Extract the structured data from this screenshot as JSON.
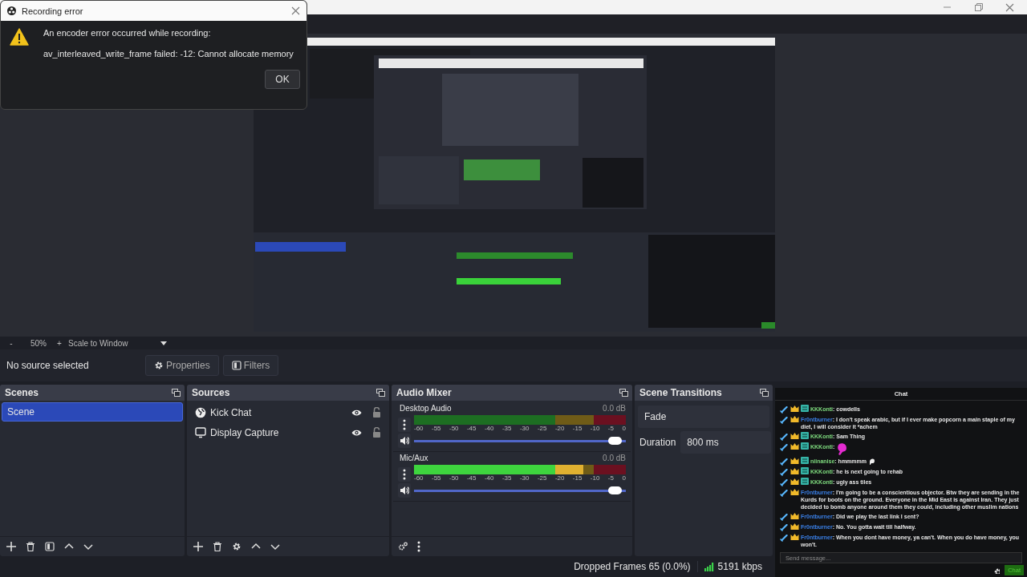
{
  "dialog": {
    "title": "Recording error",
    "message": "An encoder error occurred while recording:",
    "detail": "av_interleaved_write_frame failed: -12: Cannot allocate memory",
    "button": "OK"
  },
  "preview_toolbar": {
    "zoom_out": "-",
    "zoom": "50%",
    "zoom_in": "+",
    "scale_mode": "Scale to Window"
  },
  "source_bar": {
    "status": "No source selected",
    "properties": "Properties",
    "filters": "Filters"
  },
  "scenes": {
    "title": "Scenes",
    "items": [
      {
        "name": "Scene",
        "selected": true
      }
    ]
  },
  "sources": {
    "title": "Sources",
    "items": [
      {
        "name": "Kick Chat",
        "kind": "browser",
        "visible": true,
        "locked": false
      },
      {
        "name": "Display Capture",
        "kind": "display",
        "visible": true,
        "locked": false
      }
    ]
  },
  "audio_mixer": {
    "title": "Audio Mixer",
    "channels": [
      {
        "name": "Desktop Audio",
        "reading": "0.0 dB",
        "meter": {
          "level": 0
        },
        "scale": [
          "-60",
          "-55",
          "-50",
          "-45",
          "-40",
          "-35",
          "-30",
          "-25",
          "-20",
          "-15",
          "-10",
          "-5",
          "0"
        ],
        "volume": {
          "level": 1
        }
      },
      {
        "name": "Mic/Aux",
        "reading": "0.0 dB",
        "meter": {
          "level": 0.8
        },
        "scale": [
          "-60",
          "-55",
          "-50",
          "-45",
          "-40",
          "-35",
          "-30",
          "-25",
          "-20",
          "-15",
          "-10",
          "-5",
          "0"
        ],
        "volume": {
          "level": 1
        }
      }
    ]
  },
  "scene_transitions": {
    "title": "Scene Transitions",
    "transition": "Fade",
    "duration_label": "Duration",
    "duration": "800 ms"
  },
  "status_bar": {
    "dropped_frames": "Dropped Frames 65 (0.0%)",
    "bitrate": "5191 kbps"
  },
  "chat": {
    "title": "Chat",
    "messages": [
      {
        "user": "KKKonti",
        "color": "#7fdc7f",
        "subscriber": true,
        "text": ": cowdells",
        "emote": false
      },
      {
        "user": "Fr0ntburner",
        "color": "#3a7fe6",
        "subscriber": false,
        "text": ": I don't speak arabic, but if I ever make popcorn a main staple of my diet, I will consider it *achem",
        "emote": false
      },
      {
        "user": "KKKonti",
        "color": "#7fdc7f",
        "subscriber": true,
        "text": ": Sam Thing",
        "emote": false
      },
      {
        "user": "KKKonti",
        "color": "#7fdc7f",
        "subscriber": true,
        "text": ":",
        "emote": true
      },
      {
        "user": "niinanise",
        "color": "#7fdc7f",
        "subscriber": true,
        "text": ": hmmmmm",
        "emote": true
      },
      {
        "user": "KKKonti",
        "color": "#7fdc7f",
        "subscriber": true,
        "text": ": he is next going to rehab",
        "emote": false
      },
      {
        "user": "KKKonti",
        "color": "#7fdc7f",
        "subscriber": true,
        "text": ": ugly ass tiles",
        "emote": false
      },
      {
        "user": "Fr0ntburner",
        "color": "#3a7fe6",
        "subscriber": false,
        "text": ": I'm going to be a conscientious objector. Btw they are sending in the Kurds for boots on the ground. Everyone in the Mid East is against Iran. They just decided to bomb anyone around them they could, including other muslim nations",
        "emote": false
      },
      {
        "user": "Fr0ntburner",
        "color": "#3a7fe6",
        "subscriber": false,
        "text": ": Did we play the last link I sent?",
        "emote": false
      },
      {
        "user": "Fr0ntburner",
        "color": "#3a7fe6",
        "subscriber": false,
        "text": ": No. You gotta wait till halfway.",
        "emote": false
      },
      {
        "user": "Fr0ntburner",
        "color": "#3a7fe6",
        "subscriber": false,
        "text": ": When you dont have money, ya can't. When you do have money, you won't.",
        "emote": false
      }
    ],
    "input": {
      "placeholder": "Send message..."
    },
    "send_button": "Chat"
  }
}
